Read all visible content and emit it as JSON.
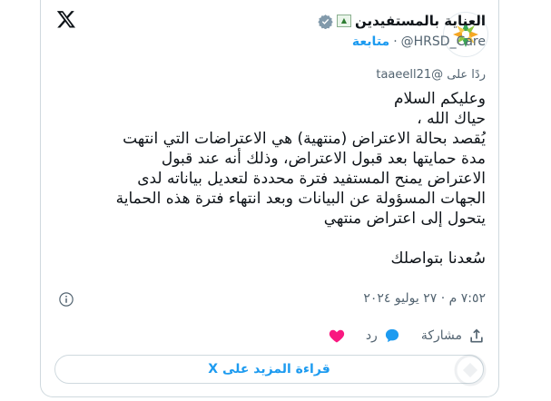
{
  "account": {
    "display_name": "العناية بالمستفيدين",
    "handle": "@HRSD_Care",
    "separator": "·",
    "follow_label": "متابعة"
  },
  "reply": {
    "prefix": "ردًا على",
    "mention": "@taaeell21"
  },
  "tweet": {
    "text": "وعليكم السلام\nحياك الله ،\nيُقصد بحالة الاعتراض (منتهية) هي الاعتراضات التي انتهت مدة حمايتها بعد قبول الاعتراض، وذلك أنه عند قبول الاعتراض يمنح المستفيد فترة محددة لتعديل بياناته لدى الجهات المسؤولة عن البيانات وبعد انتهاء فترة هذه الحماية يتحول إلى اعتراض منتهي\n\nسُعدنا بتواصلك",
    "timestamp": "٧:٥٢ م · ٢٧ يوليو ٢٠٢٤"
  },
  "actions": {
    "like_label": "",
    "reply_label": "رد",
    "share_label": "مشاركة"
  },
  "read_more_label": "قراءة المزيد على X",
  "colors": {
    "accent": "#1d9bf0",
    "like": "#f91880",
    "muted": "#536471",
    "text": "#0f1419",
    "border": "#cfd9de"
  },
  "icons": [
    "x-logo-icon",
    "verified-badge-icon",
    "flag-icon",
    "info-icon",
    "heart-icon",
    "reply-bubble-icon",
    "share-icon"
  ]
}
